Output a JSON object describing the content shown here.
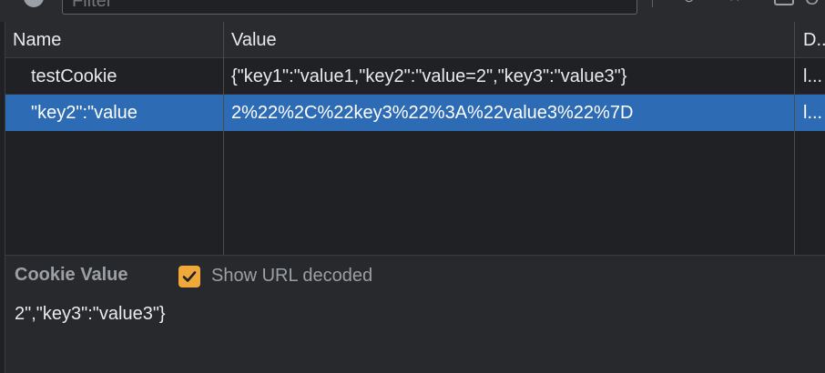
{
  "toolbar": {
    "filter_placeholder": "Filter",
    "trailing_text": "O"
  },
  "table": {
    "columns": [
      "Name",
      "Value",
      "D.."
    ],
    "rows": [
      {
        "name": "testCookie",
        "value": "{\"key1\":\"value1,\"key2\":\"value=2\",\"key3\":\"value3\"}",
        "domain": "l...",
        "selected": false
      },
      {
        "name": "\"key2\":\"value",
        "value": "2%22%2C%22key3%22%3A%22value3%22%7D",
        "domain": "l...",
        "selected": true
      }
    ]
  },
  "panel": {
    "title": "Cookie Value",
    "checkbox_label": "Show URL decoded",
    "checkbox_checked": true,
    "value": "2\",\"key3\":\"value3\"}"
  },
  "colors": {
    "background": "#202124",
    "selected_row": "#2d6bb4",
    "checkbox": "#f0a83a"
  },
  "icons": [
    "refresh-icon",
    "clear-icon",
    "close-icon",
    "block-icon",
    "checkmark-icon"
  ]
}
